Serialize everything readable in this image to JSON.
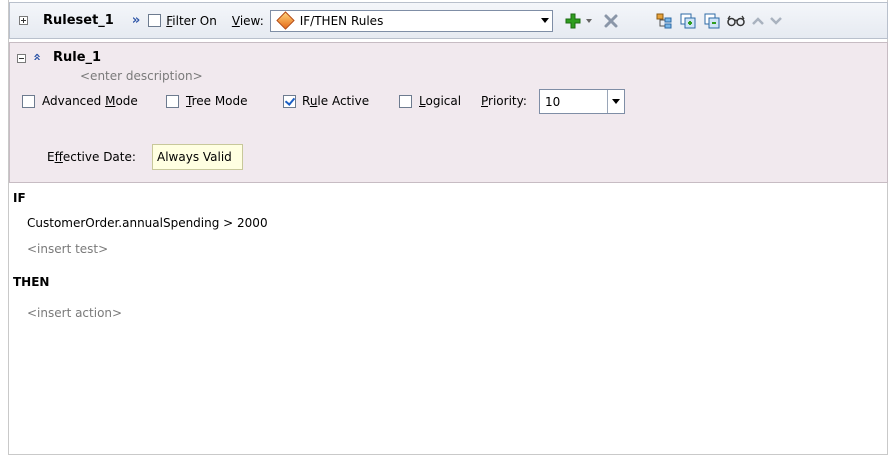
{
  "toolbar": {
    "ruleset_name": "Ruleset_1",
    "filter_label": "Filter On",
    "filter_mnemonic": "F",
    "filter_rest": "ilter On",
    "view_mnemonic": "V",
    "view_rest": "iew:",
    "view_value": "IF/THEN Rules",
    "filter_checked": false
  },
  "rule": {
    "name": "Rule_1",
    "description_placeholder": "<enter description>",
    "options": [
      {
        "pre": "Advanced ",
        "mn": "M",
        "post": "ode",
        "checked": false
      },
      {
        "pre": "",
        "mn": "T",
        "post": "ree Mode",
        "checked": false
      },
      {
        "pre": "R",
        "mn": "u",
        "post": "le Active",
        "checked": true
      },
      {
        "pre": "",
        "mn": "L",
        "post": "ogical",
        "checked": false
      }
    ],
    "priority_pre": "",
    "priority_mn": "P",
    "priority_post": "riority:",
    "priority_value": "10",
    "effective_pre": "E",
    "effective_mn": "f",
    "effective_post": "fective Date:",
    "effective_value": "Always Valid"
  },
  "body": {
    "if_label": "IF",
    "condition": "CustomerOrder.annualSpending  >  2000",
    "insert_test": "<insert test>",
    "then_label": "THEN",
    "insert_action": "<insert action>"
  },
  "colors": {
    "rule_panel_bg": "#f1e9ee",
    "add_green": "#2f9e1f",
    "delete_gray": "#8a96a8",
    "accent_blue": "#3057a8"
  }
}
